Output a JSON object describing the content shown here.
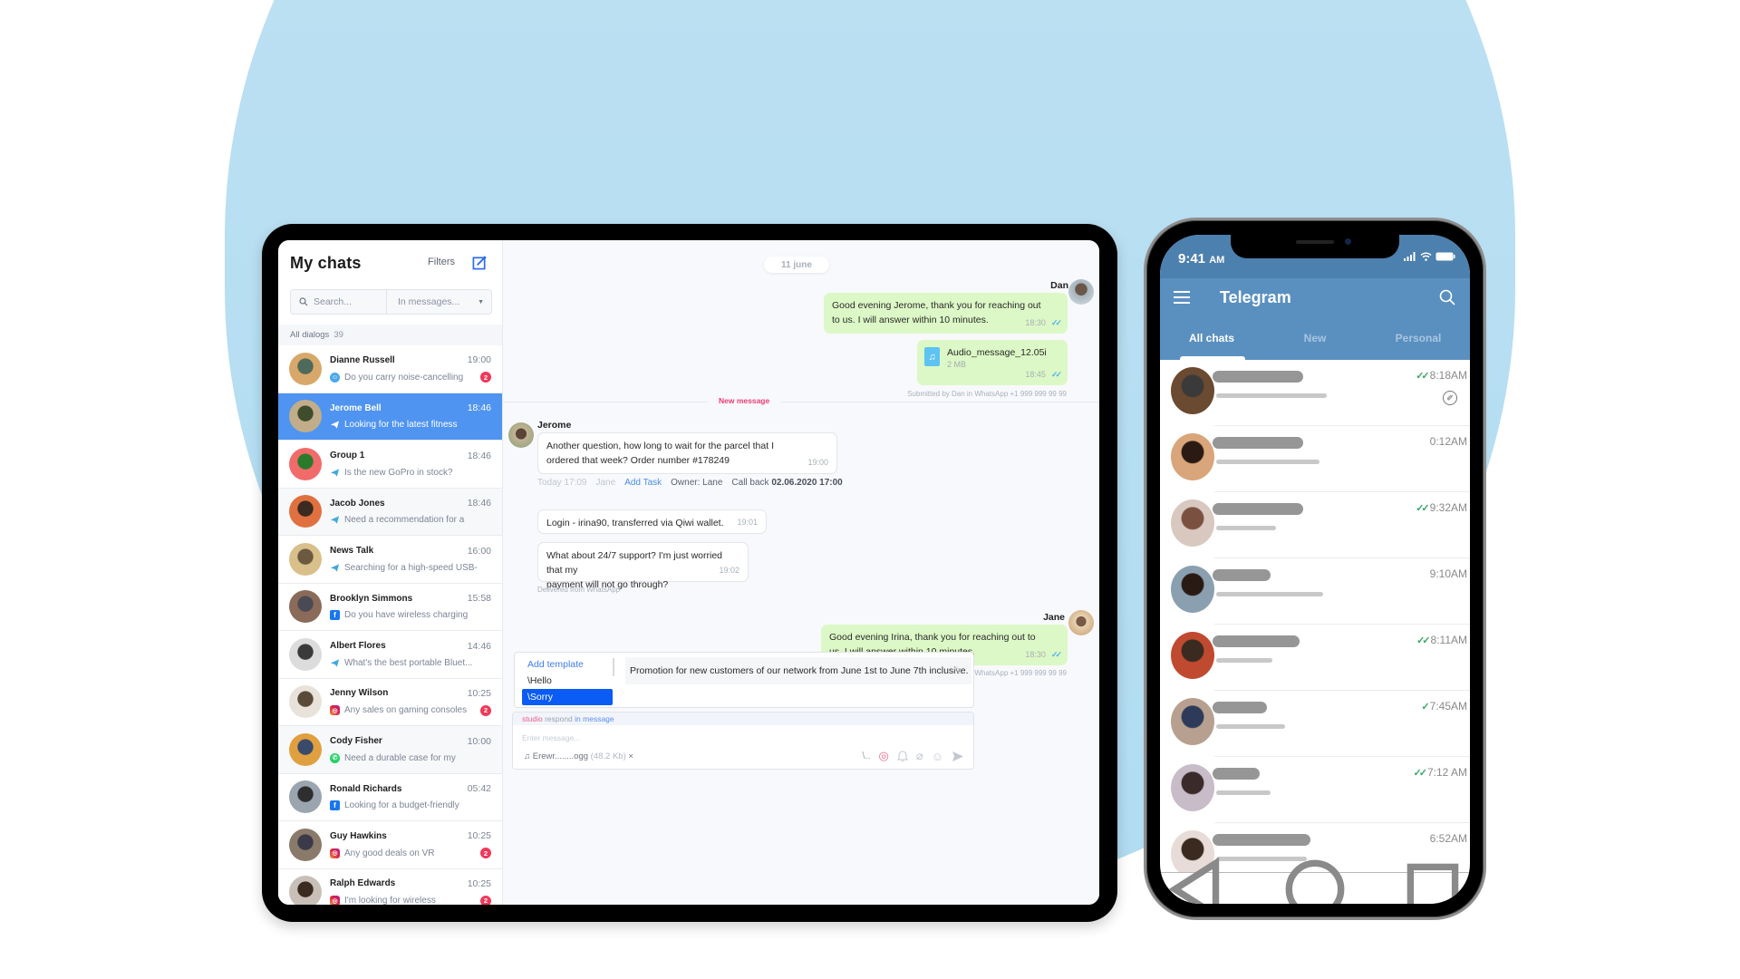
{
  "colors": {
    "background_blob": "#b5ddf1",
    "active_chat": "#4f94f0",
    "outgoing_bubble": "#dcf8c6",
    "new_message": "#ee3c72",
    "link_blue": "#4a8ee8",
    "template_selected": "#0a5cf5",
    "telegram_header": "#5a90c0",
    "telegram_status": "#4c80ae",
    "read_tick_green": "#37a86a"
  },
  "tablet": {
    "sidebar": {
      "title": "My chats",
      "filters_label": "Filters",
      "compose_icon": "compose-icon",
      "search_placeholder": "Search...",
      "search_scope": "In messages...",
      "dialogs_label": "All dialogs",
      "dialogs_count": "39",
      "chats": [
        {
          "name": "Dianne Russell",
          "time": "19:00",
          "preview": "Do you carry noise-cancelling",
          "channel": "bot",
          "badge": "2",
          "active": false
        },
        {
          "name": "Jerome Bell",
          "time": "18:46",
          "preview": "Looking for the latest fitness",
          "channel": "telegram",
          "badge": "",
          "active": true
        },
        {
          "name": "Group 1",
          "time": "18:46",
          "preview": "Is the new GoPro in stock?",
          "channel": "telegram",
          "badge": "",
          "active": false
        },
        {
          "name": "Jacob Jones",
          "time": "18:46",
          "preview": "Need a recommendation for a",
          "channel": "telegram",
          "badge": "",
          "active": false
        },
        {
          "name": "News Talk",
          "time": "16:00",
          "preview": "Searching for a high-speed USB-",
          "channel": "telegram",
          "badge": "",
          "active": false
        },
        {
          "name": "Brooklyn Simmons",
          "time": "15:58",
          "preview": "Do you have wireless charging",
          "channel": "facebook",
          "badge": "",
          "active": false
        },
        {
          "name": "Albert Flores",
          "time": "14:46",
          "preview": "What's the best portable Bluet...",
          "channel": "telegram",
          "badge": "",
          "active": false
        },
        {
          "name": "Jenny Wilson",
          "time": "10:25",
          "preview": "Any sales on gaming consoles",
          "channel": "instagram",
          "badge": "2",
          "active": false
        },
        {
          "name": "Cody Fisher",
          "time": "10:00",
          "preview": "Need a durable case for my",
          "channel": "whatsapp",
          "badge": "",
          "active": false
        },
        {
          "name": "Ronald Richards",
          "time": "05:42",
          "preview": "Looking for a budget-friendly",
          "channel": "facebook",
          "badge": "",
          "active": false
        },
        {
          "name": "Guy Hawkins",
          "time": "10:25",
          "preview": "Any good deals on VR",
          "channel": "instagram",
          "badge": "2",
          "active": false
        },
        {
          "name": "Ralph Edwards",
          "time": "10:25",
          "preview": "I'm looking for wireless",
          "channel": "instagram",
          "badge": "2",
          "active": false
        }
      ]
    },
    "chat": {
      "date_label": "11 june",
      "dan": {
        "sender": "Dan",
        "message1": {
          "line1": "Good evening Jerome, thank you for reaching out",
          "line2": "to us. I will answer within 10 minutes.",
          "time": "18:30"
        },
        "audio": {
          "filename": "Audio_message_12.05i",
          "size": "2 MB",
          "time": "18:45"
        },
        "submitted": "Submitted by Dan in WhatsApp +1 999 999 99 99"
      },
      "new_message_label": "New message",
      "jerome": {
        "sender": "Jerome",
        "message": {
          "line1": "Another question, how long to wait for the parcel that I",
          "line2": "ordered that week? Order number #178249",
          "time": "19:00"
        }
      },
      "task": {
        "when": "Today 17:09",
        "who": "Jane",
        "add_task": "Add Task",
        "owner": "Owner: Lane",
        "callback_label": "Call back",
        "callback_value": "02.06.2020 17:00"
      },
      "incoming": [
        {
          "line1": "Login - irina90, transferred via Qiwi wallet.",
          "line2": "",
          "time": "19:01"
        },
        {
          "line1": "What about 24/7 support? I'm just worried that my",
          "line2": "payment will not go through?",
          "time": "19:02"
        }
      ],
      "delivered_note": "Delivered from WhatsApp",
      "jane": {
        "sender": "Jane",
        "message": {
          "line1": "Good evening Irina, thank you for reaching out to",
          "line2": "us. I will answer within 10 minutes.",
          "time": "18:30"
        },
        "submitted": "Submitted by Jane in WhatsApp +1 999 999 99 99"
      },
      "templates": {
        "add_label": "Add template",
        "items": [
          "\\Hello",
          "\\Sorry"
        ],
        "selected": "\\Sorry",
        "preview": "Promotion for new customers of our network from June 1st to June 7th inclusive."
      },
      "composer": {
        "mode_a": "studio",
        "mode_mid": "respond",
        "mode_b": "in message",
        "placeholder": "Enter message...",
        "attachment_name": "Erewr........ogg",
        "attachment_size": "(48.2 Kb)",
        "remove": "×",
        "template_shortcut": "\\.."
      }
    }
  },
  "phone": {
    "status_time": "9:41",
    "status_ampm": "AM",
    "app_title": "Telegram",
    "tabs": [
      "All chats",
      "New",
      "Personal"
    ],
    "active_tab": "All chats",
    "chats": [
      {
        "time": "8:18AM",
        "status": "read",
        "pinned": true
      },
      {
        "time": "0:12AM",
        "status": "none",
        "pinned": false
      },
      {
        "time": "9:32AM",
        "status": "read",
        "pinned": false
      },
      {
        "time": "9:10AM",
        "status": "none",
        "pinned": false
      },
      {
        "time": "8:11AM",
        "status": "read",
        "pinned": false
      },
      {
        "time": "7:45AM",
        "status": "sent",
        "pinned": false
      },
      {
        "time": "7:12 AM",
        "status": "read",
        "pinned": false
      },
      {
        "time": "6:52AM",
        "status": "none",
        "pinned": false
      }
    ]
  }
}
